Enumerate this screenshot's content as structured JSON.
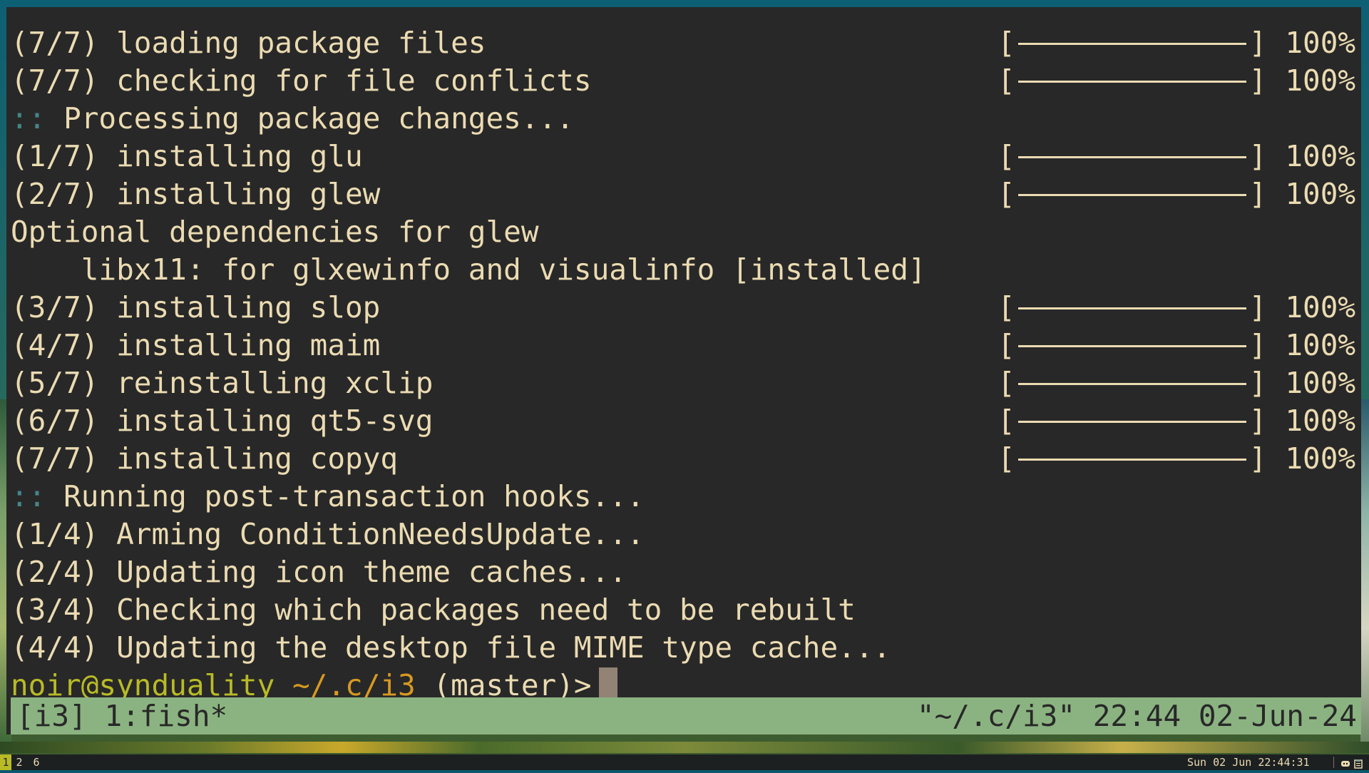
{
  "terminal": {
    "lines": [
      {
        "type": "progress",
        "text": "(7/7) loading package files",
        "percent": "100%",
        "progress": 1.0
      },
      {
        "type": "progress",
        "text": "(7/7) checking for file conflicts",
        "percent": "100%",
        "progress": 1.0
      },
      {
        "type": "section",
        "sep": "::",
        "text": "Processing package changes..."
      },
      {
        "type": "progress",
        "text": "(1/7) installing glu",
        "percent": "100%",
        "progress": 1.0
      },
      {
        "type": "progress",
        "text": "(2/7) installing glew",
        "percent": "100%",
        "progress": 1.0
      },
      {
        "type": "plain",
        "text": "Optional dependencies for glew"
      },
      {
        "type": "plain",
        "text": "    libx11: for glxewinfo and visualinfo [installed]"
      },
      {
        "type": "progress",
        "text": "(3/7) installing slop",
        "percent": "100%",
        "progress": 1.0
      },
      {
        "type": "progress",
        "text": "(4/7) installing maim",
        "percent": "100%",
        "progress": 1.0
      },
      {
        "type": "progress",
        "text": "(5/7) reinstalling xclip",
        "percent": "100%",
        "progress": 1.0
      },
      {
        "type": "progress",
        "text": "(6/7) installing qt5-svg",
        "percent": "100%",
        "progress": 1.0
      },
      {
        "type": "progress",
        "text": "(7/7) installing copyq",
        "percent": "100%",
        "progress": 1.0
      },
      {
        "type": "section",
        "sep": "::",
        "text": "Running post-transaction hooks..."
      },
      {
        "type": "plain",
        "text": "(1/4) Arming ConditionNeedsUpdate..."
      },
      {
        "type": "plain",
        "text": "(2/4) Updating icon theme caches..."
      },
      {
        "type": "plain",
        "text": "(3/4) Checking which packages need to be rebuilt"
      },
      {
        "type": "plain",
        "text": "(4/4) Updating the desktop file MIME type cache..."
      }
    ],
    "prompt": {
      "user_host": "noir@synduality",
      "path": "~/.c/i3",
      "branch": "(master)>"
    }
  },
  "tmux": {
    "session": "[i3]",
    "window": "1:fish*",
    "right": "\"~/.c/i3\" 22:44 02-Jun-24"
  },
  "i3bar": {
    "workspaces": [
      "1",
      "2",
      "6"
    ],
    "active_workspace": "1",
    "datetime": "Sun 02 Jun 22:44:31",
    "tray_icons": [
      "discord-icon",
      "clipboard-icon"
    ]
  },
  "colors": {
    "terminal_bg": "#282828",
    "foreground": "#ebdbb2",
    "tmux_bar": "#8bb381",
    "prompt_user": "#b8bb26",
    "prompt_path": "#d79921",
    "separator": "#458588"
  }
}
